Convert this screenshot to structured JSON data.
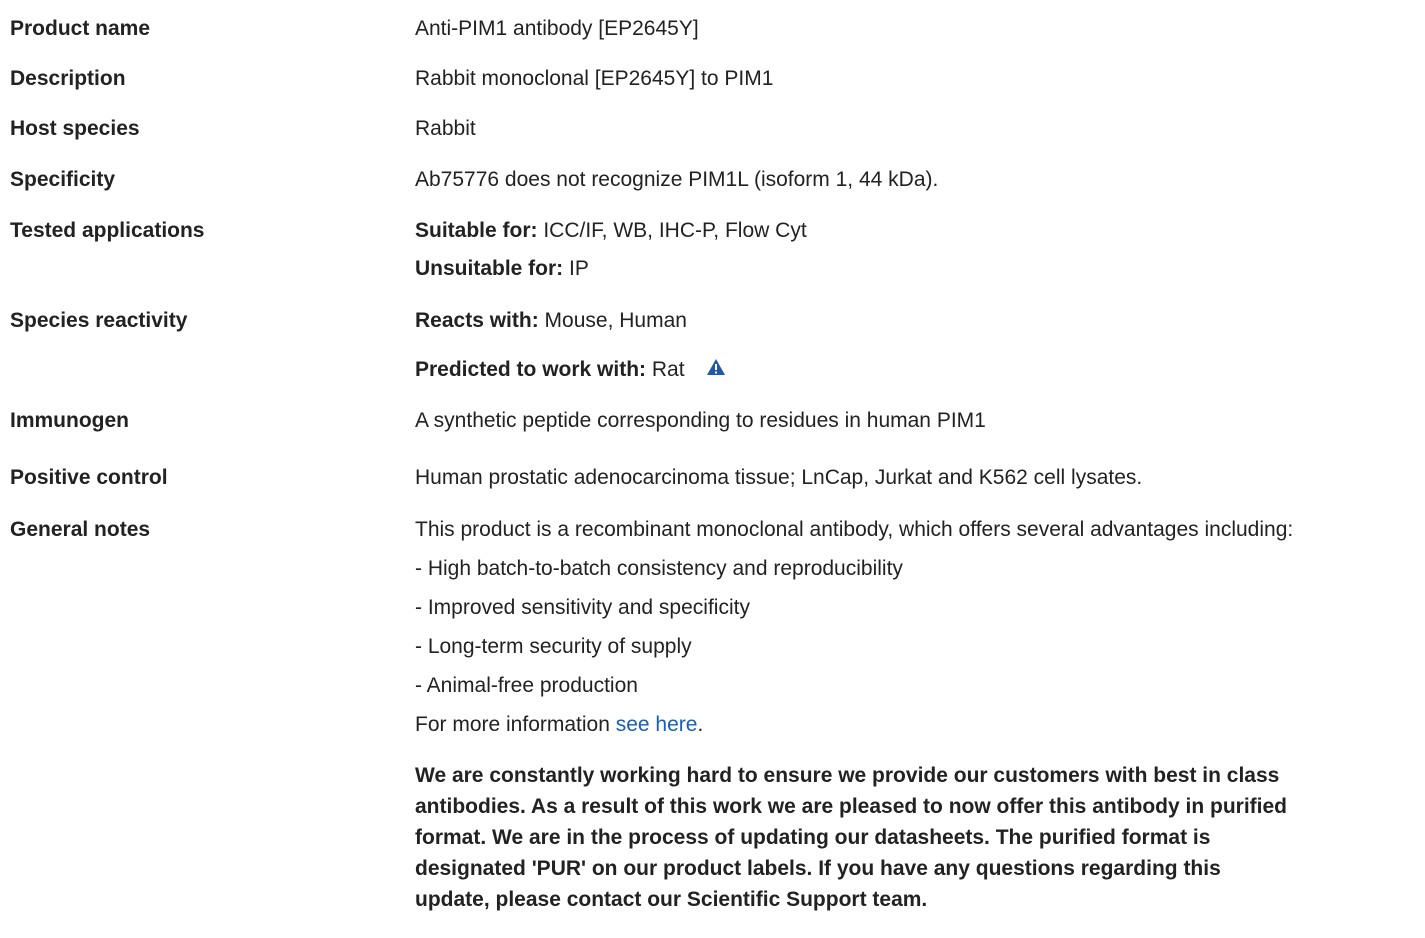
{
  "rows": {
    "product_name": {
      "label": "Product name",
      "value": "Anti-PIM1 antibody [EP2645Y]"
    },
    "description": {
      "label": "Description",
      "value": "Rabbit monoclonal [EP2645Y] to PIM1"
    },
    "host_species": {
      "label": "Host species",
      "value": "Rabbit"
    },
    "specificity": {
      "label": "Specificity",
      "value": "Ab75776 does not recognize PIM1L (isoform 1, 44 kDa)."
    },
    "tested_applications": {
      "label": "Tested applications",
      "suitable_label": "Suitable for:",
      "suitable_value": " ICC/IF, WB, IHC-P, Flow Cyt",
      "unsuitable_label": "Unsuitable for:",
      "unsuitable_value": " IP"
    },
    "species_reactivity": {
      "label": "Species reactivity",
      "reacts_label": "Reacts with:",
      "reacts_value": " Mouse, Human",
      "predicted_label": "Predicted to work with:",
      "predicted_value": " Rat",
      "warning_icon": "warning-triangle-icon"
    },
    "immunogen": {
      "label": "Immunogen",
      "value": "A synthetic peptide corresponding to residues in human PIM1"
    },
    "positive_control": {
      "label": "Positive control",
      "value": "Human prostatic adenocarcinoma tissue; LnCap, Jurkat and K562 cell lysates."
    },
    "general_notes": {
      "label": "General notes",
      "intro": "This product is a recombinant monoclonal antibody, which offers several advantages including:",
      "bullets": [
        "- High batch-to-batch consistency and reproducibility",
        "- Improved sensitivity and specificity",
        "- Long-term security of supply",
        "- Animal-free production"
      ],
      "more_info_prefix": "For more information ",
      "more_info_link": "see here",
      "more_info_suffix": ".",
      "notice_lines": [
        "We are constantly working hard to ensure we provide our customers with best in class",
        "antibodies. As a result of this work we are pleased to now offer this antibody in purified",
        "format. We are in the process of updating our datasheets. The purified format is",
        "designated 'PUR' on our product labels. If you have any questions regarding this",
        "update, please contact our Scientific Support team."
      ]
    }
  },
  "colors": {
    "text": "#222222",
    "link": "#1a5fb4",
    "warning_icon": "#1f5aa6"
  }
}
